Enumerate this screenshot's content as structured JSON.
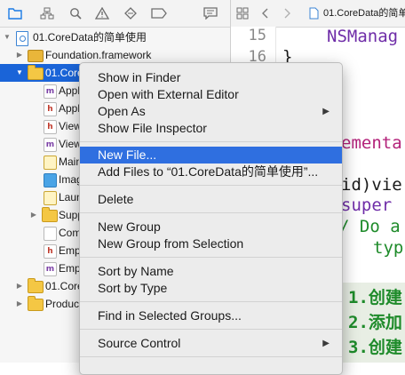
{
  "navigator": {
    "toolbar_icons": [
      "folder-icon",
      "hierarchy-icon",
      "search-icon",
      "warning-icon",
      "diamond-icon",
      "breakpoint-icon",
      "report-icon"
    ],
    "rows": [
      {
        "label": "01.CoreData的简单使用",
        "icon": "project-icon",
        "disclosure": "▼"
      },
      {
        "label": "Foundation.framework",
        "icon": "framework-icon",
        "disclosure": "▶"
      },
      {
        "label": "01.CoreD",
        "icon": "folder-icon",
        "disclosure": "▼"
      },
      {
        "label": "Appl",
        "icon": "m-file-icon"
      },
      {
        "label": "Appl",
        "icon": "h-file-icon"
      },
      {
        "label": "View",
        "icon": "h-file-icon"
      },
      {
        "label": "View",
        "icon": "m-file-icon"
      },
      {
        "label": "Main",
        "icon": "storyboard-icon"
      },
      {
        "label": "Imag",
        "icon": "asset-catalog-icon"
      },
      {
        "label": "Laun",
        "icon": "storyboard-icon"
      },
      {
        "label": "Supp",
        "icon": "folder-icon",
        "disclosure": "▶"
      },
      {
        "label": "Com",
        "icon": "coredata-model-icon"
      },
      {
        "label": "Emp",
        "icon": "h-file-icon"
      },
      {
        "label": "Emp",
        "icon": "m-file-icon"
      },
      {
        "label": "01.Core",
        "icon": "folder-icon",
        "disclosure": "▶"
      },
      {
        "label": "Produc",
        "icon": "folder-icon",
        "disclosure": "▶"
      }
    ]
  },
  "editor": {
    "jump_bar": {
      "grid_icon": "grid-icon",
      "back_icon": "back-arrow-icon",
      "forward_icon": "forward-arrow-icon",
      "file_title": "01.CoreData的简单"
    },
    "line_numbers": [
      "15",
      "16"
    ],
    "code_lines": [
      {
        "text": "NSManag",
        "color": "#6f2da8"
      },
      {
        "text": "}",
        "color": "#1a1a1a"
      },
      {
        "text": "ementa",
        "color": "#b3227a"
      },
      {
        "text": "id)vie",
        "color": "#1a1a1a"
      },
      {
        "text": "super",
        "color": "#6f2da8"
      },
      {
        "text": "/ Do a",
        "color": "#1e8b2a"
      },
      {
        "text": "typ",
        "color": "#1e8b2a"
      }
    ],
    "comment_lines": [
      "1.创建",
      "2.添加",
      "3.创建"
    ]
  },
  "context_menu": {
    "groups": [
      [
        {
          "label": "Show in Finder"
        },
        {
          "label": "Open with External Editor"
        },
        {
          "label": "Open As",
          "submenu": true
        },
        {
          "label": "Show File Inspector"
        }
      ],
      [
        {
          "label": "New File...",
          "highlighted": true
        },
        {
          "label": "Add Files to “01.CoreData的简单使用”..."
        }
      ],
      [
        {
          "label": "Delete"
        }
      ],
      [
        {
          "label": "New Group"
        },
        {
          "label": "New Group from Selection"
        }
      ],
      [
        {
          "label": "Sort by Name"
        },
        {
          "label": "Sort by Type"
        }
      ],
      [
        {
          "label": "Find in Selected Groups..."
        }
      ],
      [
        {
          "label": "Source Control",
          "submenu": true
        }
      ]
    ],
    "submenu_arrow": "▶"
  }
}
